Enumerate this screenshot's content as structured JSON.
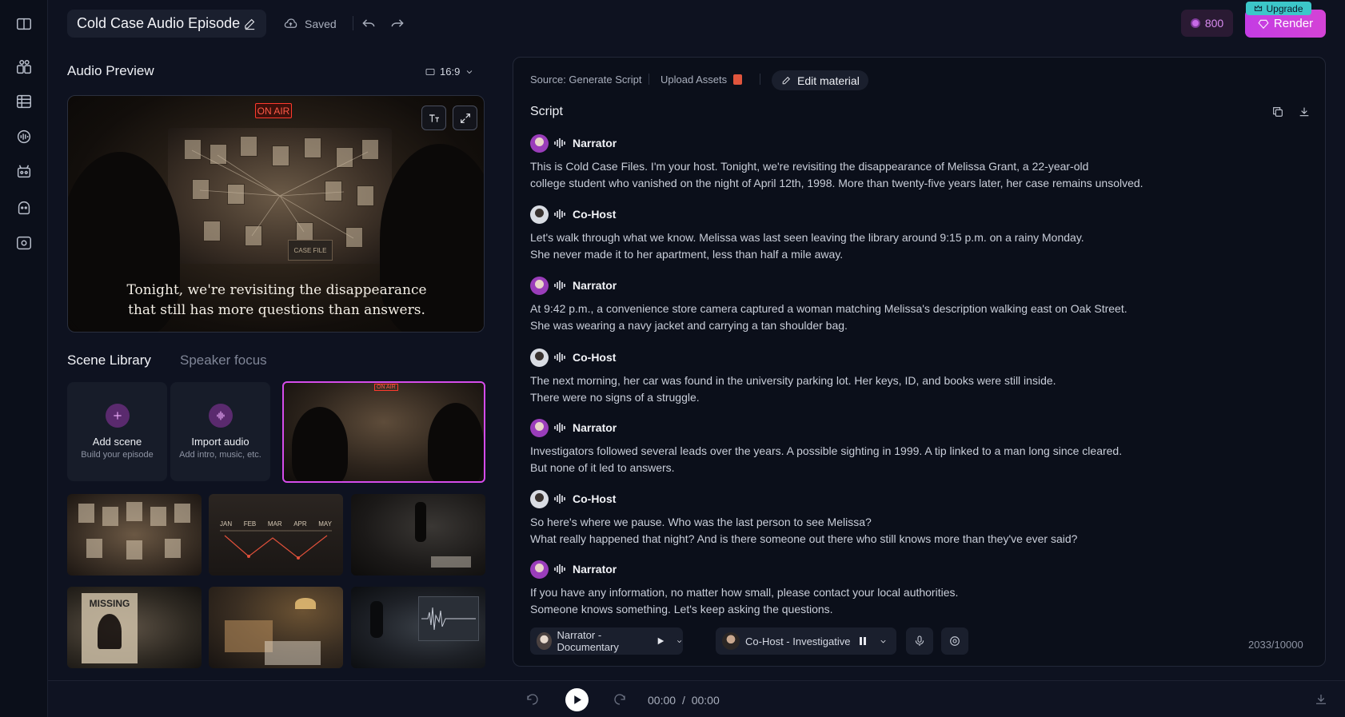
{
  "header": {
    "title": "Cold Case Audio Episode",
    "saved_label": "Saved",
    "credits": "800",
    "render_label": "Render",
    "upgrade_label": "Upgrade"
  },
  "preview": {
    "title": "Audio Preview",
    "aspect_ratio": "16:9",
    "sign_on_air": "ON AIR",
    "sign_case_file": "CASE FILE",
    "subtitle_line1": "Tonight, we're revisiting the disappearance",
    "subtitle_line2": "that still has more questions than answers."
  },
  "library": {
    "tab_active": "Scene Library",
    "tab_inactive": "Speaker focus",
    "add_scene": {
      "label": "Add scene",
      "sub": "Build your episode"
    },
    "import_audio": {
      "label": "Import audio",
      "sub": "Add intro, music, etc."
    },
    "thumb_selected_sign": "ON AIR",
    "timeline_months": [
      "JAN",
      "FEB",
      "MAR",
      "APR",
      "MAY"
    ],
    "missing_poster": "MISSING"
  },
  "script_panel": {
    "source_label": "Source: Generate Script",
    "upload_label": "Upload Assets",
    "edit_label": "Edit material",
    "title": "Script",
    "entries": [
      {
        "speaker": "Narrator",
        "line1": "This is Cold Case Files. I'm your host. Tonight, we're revisiting the disappearance of Melissa Grant, a 22-year-old",
        "line2": "college student who vanished on the night of April 12th, 1998. More than twenty-five years later, her case remains unsolved."
      },
      {
        "speaker": "Co-Host",
        "line1": "Let's walk through what we know. Melissa was last seen leaving the library around 9:15 p.m. on a rainy Monday.",
        "line2": "She never made it to her apartment, less than half a mile away."
      },
      {
        "speaker": "Narrator",
        "line1": "At 9:42 p.m., a convenience store camera captured a woman matching Melissa's description walking east on Oak Street.",
        "line2": "She was wearing a navy jacket and carrying a tan shoulder bag."
      },
      {
        "speaker": "Co-Host",
        "line1": "The next morning, her car was found in the university parking lot. Her keys, ID, and books were still inside.",
        "line2": "There were no signs of a struggle."
      },
      {
        "speaker": "Narrator",
        "line1": "Investigators followed several leads over the years. A possible sighting in 1999. A tip linked to a man long since cleared.",
        "line2": "But none of it led to answers."
      },
      {
        "speaker": "Co-Host",
        "line1": "So here's where we pause. Who was the last person to see Melissa?",
        "line2": "What really happened that night? And is there someone out there who still knows more than they've ever said?"
      },
      {
        "speaker": "Narrator",
        "line1": "If you have any information, no matter how small, please contact your local authorities.",
        "line2": "Someone knows something. Let's keep asking the questions."
      }
    ],
    "voice_narrator": "Narrator - Documentary",
    "voice_cohost": "Co-Host - Investigative",
    "char_count": "2033/10000"
  },
  "transport": {
    "time_current": "00:00",
    "time_sep": "/",
    "time_total": "00:00"
  },
  "colors": {
    "accent": "#d443d6",
    "upgrade": "#3cc6c9",
    "background": "#0e1220",
    "panel": "#0b0f1a"
  }
}
